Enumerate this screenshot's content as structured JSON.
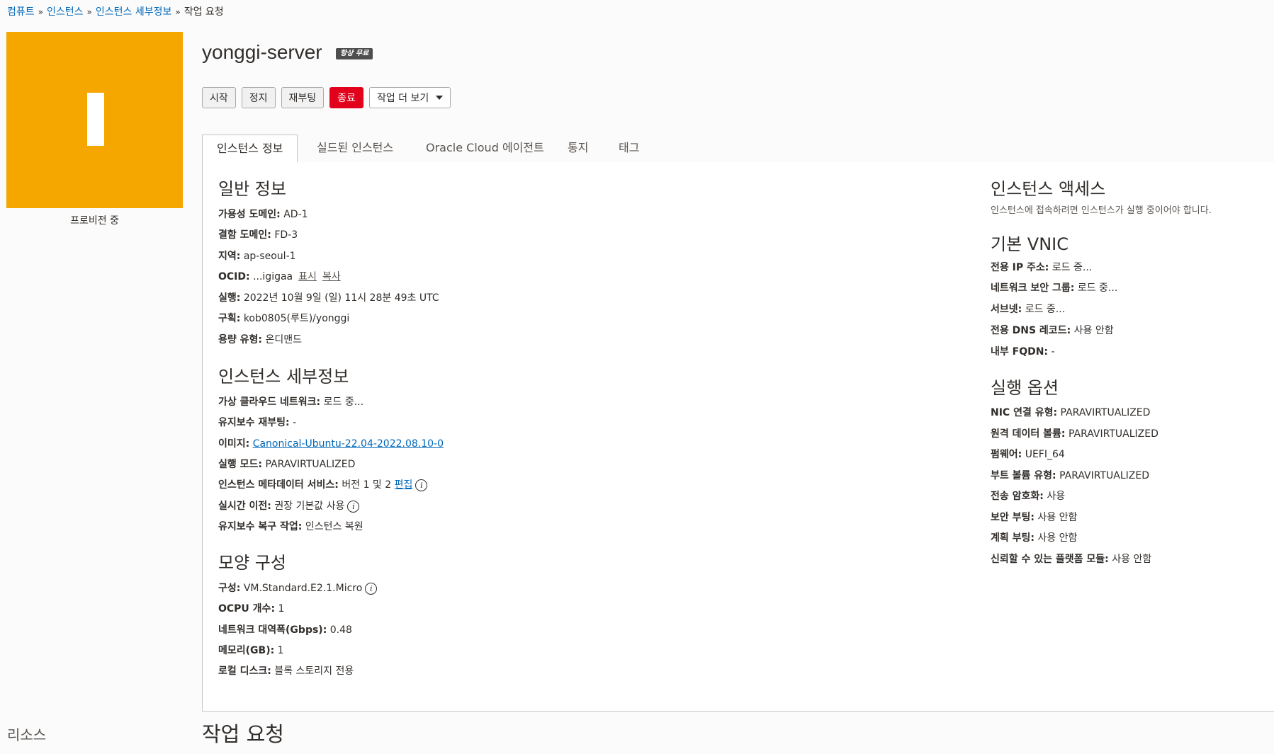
{
  "breadcrumb": {
    "items": [
      "컴퓨트",
      "인스턴스",
      "인스턴스 세부정보"
    ],
    "current": "작업 요청",
    "separator": "»"
  },
  "instance": {
    "state_caption": "프로비전 중",
    "state_letter_icon": "instance-state-icon",
    "name": "yonggi-server",
    "badge": "항상 무료"
  },
  "actions": {
    "start": "시작",
    "stop": "정지",
    "reboot": "재부팅",
    "terminate": "종료",
    "more": "작업 더 보기"
  },
  "tabs": [
    "인스턴스 정보",
    "실드된 인스턴스",
    "Oracle Cloud 에이전트",
    "통지",
    "태그"
  ],
  "general": {
    "title": "일반 정보",
    "rows": [
      {
        "k": "가용성 도메인:",
        "v": "AD-1"
      },
      {
        "k": "결함 도메인:",
        "v": "FD-3"
      },
      {
        "k": "지역:",
        "v": "ap-seoul-1"
      },
      {
        "k": "OCID:",
        "v": "...igigaa",
        "show": "표시",
        "copy": "복사"
      },
      {
        "k": "실행:",
        "v": "2022년 10월 9일 (일) 11시 28분 49초 UTC"
      },
      {
        "k": "구획:",
        "v": "kob0805(루트)/yonggi"
      },
      {
        "k": "용량 유형:",
        "v": "온디맨드"
      }
    ]
  },
  "details": {
    "title": "인스턴스 세부정보",
    "rows": [
      {
        "k": "가상 클라우드 네트워크:",
        "v": "로드 중..."
      },
      {
        "k": "유지보수 재부팅:",
        "v": "-"
      },
      {
        "k": "이미지:",
        "v": "Canonical-Ubuntu-22.04-2022.08.10-0"
      },
      {
        "k": "실행 모드:",
        "v": "PARAVIRTUALIZED"
      },
      {
        "k": "인스턴스 메타데이터 서비스:",
        "v": "버전 1 및 2",
        "edit": "편집"
      },
      {
        "k": "실시간 이전:",
        "v": "권장 기본값 사용"
      },
      {
        "k": "유지보수 복구 작업:",
        "v": "인스턴스 복원"
      }
    ]
  },
  "shape": {
    "title": "모양 구성",
    "rows": [
      {
        "k": "구성:",
        "v": "VM.Standard.E2.1.Micro"
      },
      {
        "k": "OCPU 개수:",
        "v": "1"
      },
      {
        "k": "네트워크 대역폭(Gbps):",
        "v": "0.48"
      },
      {
        "k": "메모리(GB):",
        "v": "1"
      },
      {
        "k": "로컬 디스크:",
        "v": "블록 스토리지 전용"
      }
    ]
  },
  "access": {
    "title": "인스턴스 액세스",
    "note": "인스턴스에 접속하려면 인스턴스가 실행 중이어야 합니다."
  },
  "vnic": {
    "title": "기본 VNIC",
    "rows": [
      {
        "k": "전용 IP 주소:",
        "v": "로드 중..."
      },
      {
        "k": "네트워크 보안 그룹:",
        "v": "로드 중..."
      },
      {
        "k": "서브넷:",
        "v": "로드 중..."
      },
      {
        "k": "전용 DNS 레코드:",
        "v": "사용 안함"
      },
      {
        "k": "내부 FQDN:",
        "v": "-"
      }
    ]
  },
  "launch": {
    "title": "실행 옵션",
    "rows": [
      {
        "k": "NIC 연결 유형:",
        "v": "PARAVIRTUALIZED"
      },
      {
        "k": "원격 데이터 볼륨:",
        "v": "PARAVIRTUALIZED"
      },
      {
        "k": "펌웨어:",
        "v": "UEFI_64"
      },
      {
        "k": "부트 볼륨 유형:",
        "v": "PARAVIRTUALIZED"
      },
      {
        "k": "전송 암호화:",
        "v": "사용"
      },
      {
        "k": "보안 부팅:",
        "v": "사용 안함"
      },
      {
        "k": "계획 부팅:",
        "v": "사용 안함"
      },
      {
        "k": "신뢰할 수 있는 플랫폼 모듈:",
        "v": "사용 안함"
      }
    ]
  },
  "bottom": {
    "resources": "리소스",
    "work_requests": "작업 요청"
  },
  "colors": {
    "state": "#f5a700",
    "danger": "#e3001a",
    "link": "#0067b8"
  }
}
